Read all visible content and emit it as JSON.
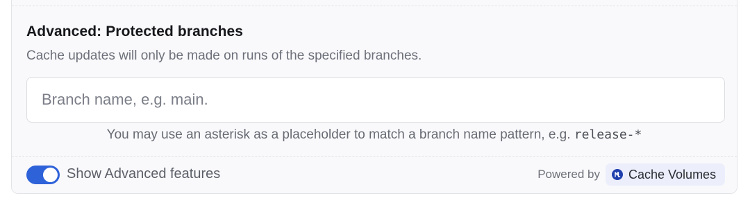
{
  "protected_branches": {
    "title": "Advanced: Protected branches",
    "description": "Cache updates will only be made on runs of the specified branches.",
    "input_placeholder": "Branch name, e.g. main.",
    "input_value": "",
    "hint_prefix": "You may use an asterisk as a placeholder to match a branch name pattern, e.g.",
    "hint_example": "release-*"
  },
  "footer": {
    "toggle_label": "Show Advanced features",
    "toggle_on": true,
    "powered_by_label": "Powered by",
    "badge_label": "Cache Volumes",
    "badge_icon": "cache-volumes-logo-icon"
  },
  "colors": {
    "toggle_on": "#2e62d9",
    "badge_background": "#eceffb",
    "badge_icon": "#1f3fae"
  }
}
